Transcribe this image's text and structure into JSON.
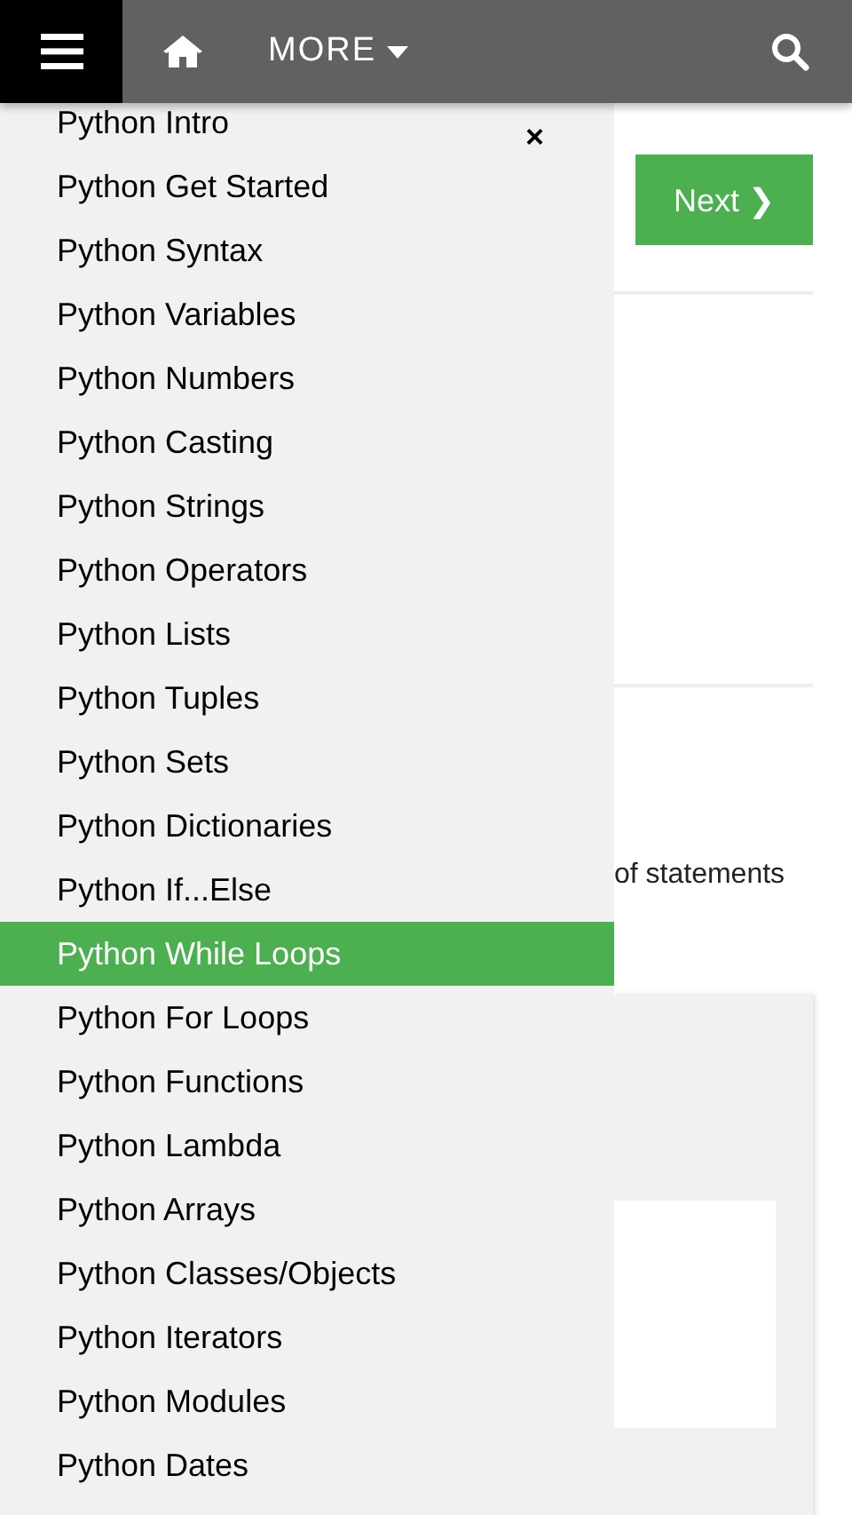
{
  "top_bar": {
    "more_label": "MORE"
  },
  "sidebar": {
    "close_label": "×",
    "items": [
      {
        "label": "Python Intro",
        "selected": false
      },
      {
        "label": "Python Get Started",
        "selected": false
      },
      {
        "label": "Python Syntax",
        "selected": false
      },
      {
        "label": "Python Variables",
        "selected": false
      },
      {
        "label": "Python Numbers",
        "selected": false
      },
      {
        "label": "Python Casting",
        "selected": false
      },
      {
        "label": "Python Strings",
        "selected": false
      },
      {
        "label": "Python Operators",
        "selected": false
      },
      {
        "label": "Python Lists",
        "selected": false
      },
      {
        "label": "Python Tuples",
        "selected": false
      },
      {
        "label": "Python Sets",
        "selected": false
      },
      {
        "label": "Python Dictionaries",
        "selected": false
      },
      {
        "label": "Python If...Else",
        "selected": false
      },
      {
        "label": "Python While Loops",
        "selected": true
      },
      {
        "label": "Python For Loops",
        "selected": false
      },
      {
        "label": "Python Functions",
        "selected": false
      },
      {
        "label": "Python Lambda",
        "selected": false
      },
      {
        "label": "Python Arrays",
        "selected": false
      },
      {
        "label": "Python Classes/Objects",
        "selected": false
      },
      {
        "label": "Python Iterators",
        "selected": false
      },
      {
        "label": "Python Modules",
        "selected": false
      },
      {
        "label": "Python Dates",
        "selected": false
      }
    ]
  },
  "content": {
    "next_button": "Next ❯",
    "partial_text": "of statements"
  }
}
